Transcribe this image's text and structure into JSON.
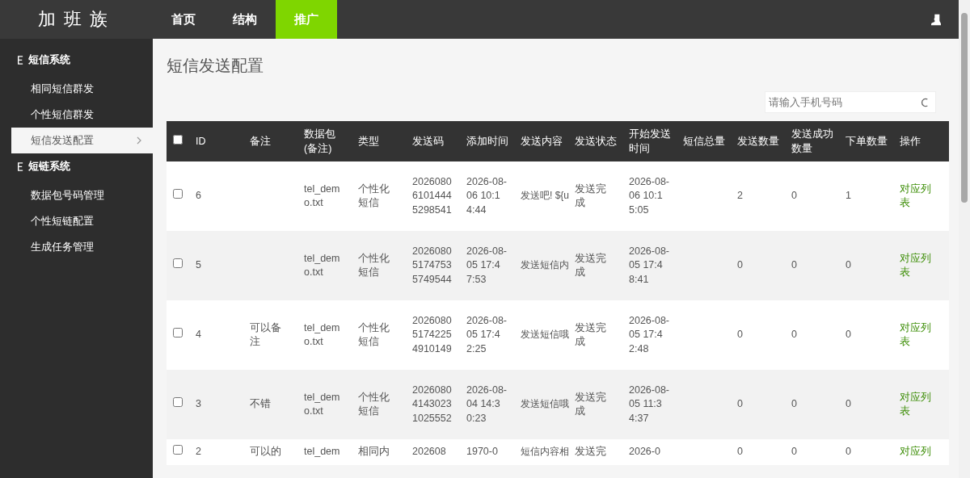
{
  "header": {
    "logo": "加班族",
    "nav": [
      {
        "label": "首页",
        "selected": false
      },
      {
        "label": "结构",
        "selected": false
      },
      {
        "label": "推广",
        "selected": true
      }
    ]
  },
  "sidebar": {
    "groups": [
      {
        "title": "短信系统",
        "items": [
          {
            "label": "相同短信群发",
            "selected": false
          },
          {
            "label": "个性短信群发",
            "selected": false
          },
          {
            "label": "短信发送配置",
            "selected": true
          }
        ]
      },
      {
        "title": "短链系统",
        "items": [
          {
            "label": "数据包号码管理",
            "selected": false
          },
          {
            "label": "个性短链配置",
            "selected": false
          },
          {
            "label": "生成任务管理",
            "selected": false
          }
        ]
      }
    ]
  },
  "page": {
    "title": "短信发送配置"
  },
  "search": {
    "placeholder": "请输入手机号码"
  },
  "table": {
    "select_all": {
      "checked": false
    },
    "columns": [
      "ID",
      "备注",
      "数据包(备注)",
      "类型",
      "发送码",
      "添加时间",
      "发送内容",
      "发送状态",
      "开始发送时间",
      "短信总量",
      "发送数量",
      "发送成功数量",
      "下单数量",
      "操作"
    ],
    "rows": [
      {
        "checked": false,
        "cells": [
          "6",
          "",
          "tel_demo.txt",
          "个性化短信",
          "202608061014445298541",
          "2026-08-06 10:14:44",
          "发送吧! ${u",
          "发送完成",
          "2026-08-06 10:15:05",
          "",
          "2",
          "0",
          "1",
          "对应列表"
        ]
      },
      {
        "checked": false,
        "cells": [
          "5",
          "",
          "tel_demo.txt",
          "个性化短信",
          "202608051747535749544",
          "2026-08-05 17:47:53",
          "发送短信内",
          "发送完成",
          "2026-08-05 17:48:41",
          "",
          "0",
          "0",
          "0",
          "对应列表"
        ]
      },
      {
        "checked": false,
        "cells": [
          "4",
          "可以备注",
          "tel_demo.txt",
          "个性化短信",
          "202608051742254910149",
          "2026-08-05 17:42:25",
          "发送短信哦",
          "发送完成",
          "2026-08-05 17:42:48",
          "",
          "0",
          "0",
          "0",
          "对应列表"
        ]
      },
      {
        "checked": false,
        "cells": [
          "3",
          "不错",
          "tel_demo.txt",
          "个性化短信",
          "202608041430231025552",
          "2026-08-04 14:30:23",
          "发送短信哦",
          "发送完成",
          "2026-08-05 11:34:37",
          "",
          "0",
          "0",
          "0",
          "对应列表"
        ]
      },
      {
        "checked": false,
        "cells": [
          "2",
          "可以的",
          "tel_dem",
          "相同内",
          "202608",
          "1970-0",
          "短信内容相",
          "发送完",
          "2026-0",
          "",
          "0",
          "0",
          "0",
          "对应列"
        ]
      }
    ]
  }
}
